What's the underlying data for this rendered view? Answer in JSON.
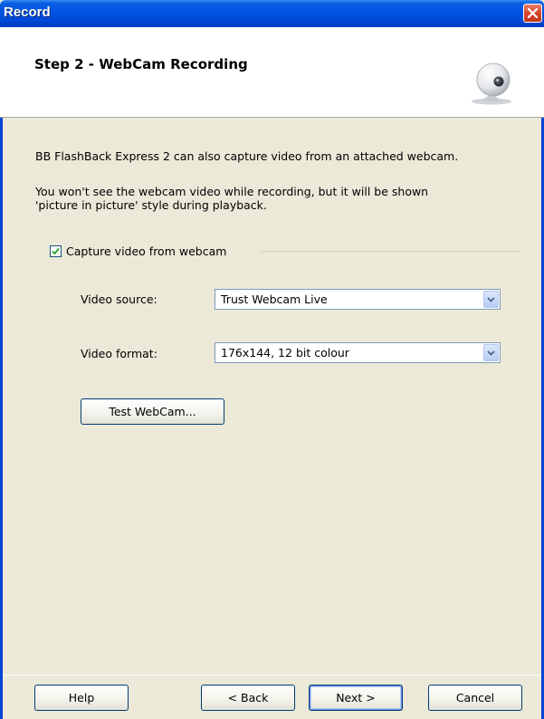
{
  "window": {
    "title": "Record",
    "close_icon": "close-icon"
  },
  "header": {
    "step_title": "Step 2 - WebCam Recording",
    "icon": "webcam-icon"
  },
  "body": {
    "intro": "BB FlashBack Express 2 can also capture video from an attached webcam.",
    "note_line1": "You won't see the webcam video while recording, but it will be shown",
    "note_line2": "'picture in picture' style during playback.",
    "capture_checkbox": {
      "label": "Capture video from webcam",
      "checked": true
    },
    "video_source": {
      "label": "Video source:",
      "value": "Trust Webcam Live"
    },
    "video_format": {
      "label": "Video format:",
      "value": "176x144, 12 bit colour"
    },
    "test_button": "Test WebCam..."
  },
  "footer": {
    "help": "Help",
    "back": "< Back",
    "next": "Next >",
    "cancel": "Cancel"
  },
  "colors": {
    "titlebar": "#0054e3",
    "dialog_bg": "#ece9d8",
    "check": "#21a121"
  }
}
